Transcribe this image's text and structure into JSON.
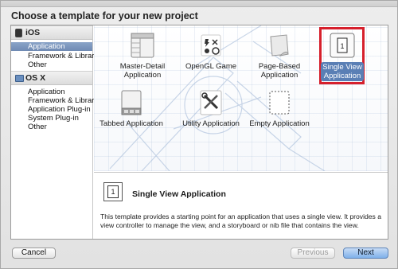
{
  "sheet": {
    "title": "Choose a template for your new project"
  },
  "sidebar": {
    "groups": [
      {
        "label": "iOS",
        "items": [
          "Application",
          "Framework & Library",
          "Other"
        ]
      },
      {
        "label": "OS X",
        "items": [
          "Application",
          "Framework & Library",
          "Application Plug-in",
          "System Plug-in",
          "Other"
        ]
      }
    ],
    "selected": "iOS / Application"
  },
  "templates": [
    {
      "label": "Master-Detail Application",
      "icon": "master-detail-icon"
    },
    {
      "label": "OpenGL Game",
      "icon": "opengl-game-icon"
    },
    {
      "label": "Page-Based Application",
      "icon": "page-based-icon"
    },
    {
      "label": "Single View Application",
      "icon": "single-view-icon",
      "selected": true
    },
    {
      "label": "Tabbed Application",
      "icon": "tabbed-icon"
    },
    {
      "label": "Utility Application",
      "icon": "utility-icon"
    },
    {
      "label": "Empty Application",
      "icon": "empty-icon"
    }
  ],
  "detail": {
    "icon_text": "1",
    "title": "Single View Application",
    "description": "This template provides a starting point for an application that uses a single view. It provides a view controller to manage the view, and a storyboard or nib file that contains the view."
  },
  "buttons": {
    "cancel": "Cancel",
    "previous": "Previous",
    "next": "Next"
  },
  "colors": {
    "selection_frame": "#d6202c",
    "selected_label_bg": "#5a7fb5",
    "sidebar_selected": "#7f98bf"
  }
}
